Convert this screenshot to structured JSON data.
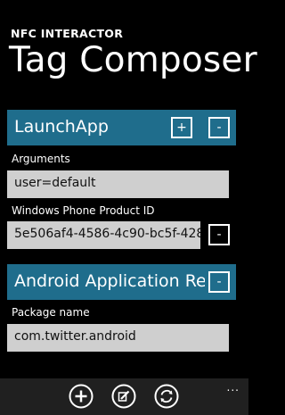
{
  "app": {
    "name": "NFC INTERACTOR"
  },
  "page": {
    "title": "Tag Composer"
  },
  "records": [
    {
      "title": "LaunchApp",
      "add_label": "+",
      "remove_label": "-",
      "fields": [
        {
          "label": "Arguments",
          "value": "user=default"
        },
        {
          "label": "Windows Phone Product ID",
          "value": "5e506af4-4586-4c90-bc5f-428",
          "remove_label": "-"
        }
      ]
    },
    {
      "title": "Android Application Reco",
      "remove_label": "-",
      "fields": [
        {
          "label": "Package name",
          "value": "com.twitter.android"
        }
      ]
    }
  ],
  "appbar": {
    "icons": [
      "add-icon",
      "edit-icon",
      "sync-icon"
    ],
    "more": "..."
  },
  "colors": {
    "background": "#000000",
    "record_header": "#1f6d8c",
    "input_background": "#cfcfcf",
    "appbar": "#202020"
  }
}
